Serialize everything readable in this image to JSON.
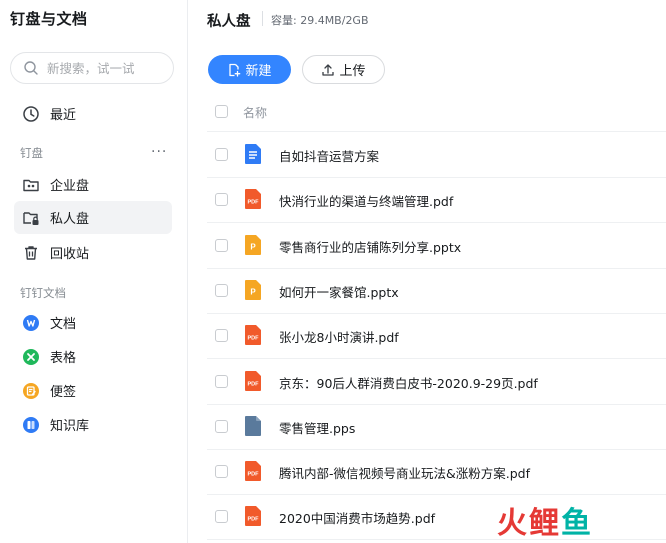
{
  "sidebar": {
    "title": "钉盘与文档",
    "search_placeholder": "新搜索，试一试",
    "recent_label": "最近",
    "section_dingpan": "钉盘",
    "more_glyph": "···",
    "items": [
      {
        "label": "企业盘"
      },
      {
        "label": "私人盘"
      },
      {
        "label": "回收站"
      }
    ],
    "section_docs": "钉钉文档",
    "doc_items": [
      {
        "label": "文档"
      },
      {
        "label": "表格"
      },
      {
        "label": "便签"
      },
      {
        "label": "知识库"
      }
    ]
  },
  "main": {
    "title": "私人盘",
    "capacity": "容量: 29.4MB/2GB",
    "new_button": "新建",
    "upload_button": "上传",
    "column_name": "名称",
    "files": [
      {
        "name": "自如抖音运营方案",
        "type": "doc"
      },
      {
        "name": "快消行业的渠道与终端管理.pdf",
        "type": "pdf"
      },
      {
        "name": "零售商行业的店铺陈列分享.pptx",
        "type": "pptx"
      },
      {
        "name": "如何开一家餐馆.pptx",
        "type": "pptx"
      },
      {
        "name": "张小龙8小时演讲.pdf",
        "type": "pdf"
      },
      {
        "name": "京东：90后人群消费白皮书-2020.9-29页.pdf",
        "type": "pdf"
      },
      {
        "name": "零售管理.pps",
        "type": "pps"
      },
      {
        "name": "腾讯内部-微信视频号商业玩法&涨粉方案.pdf",
        "type": "pdf"
      },
      {
        "name": "2020中国消费市场趋势.pdf",
        "type": "pdf"
      }
    ]
  },
  "watermark": {
    "chars": [
      "火",
      "鲤",
      "鱼"
    ]
  },
  "colors": {
    "accent": "#3385ff",
    "pdf": "#f15a2b",
    "pptx": "#f5a623",
    "doc": "#2f7bf5",
    "pps": "#5a7a9c",
    "watermark_red": "#e53935",
    "watermark_teal": "#00b3a6"
  }
}
